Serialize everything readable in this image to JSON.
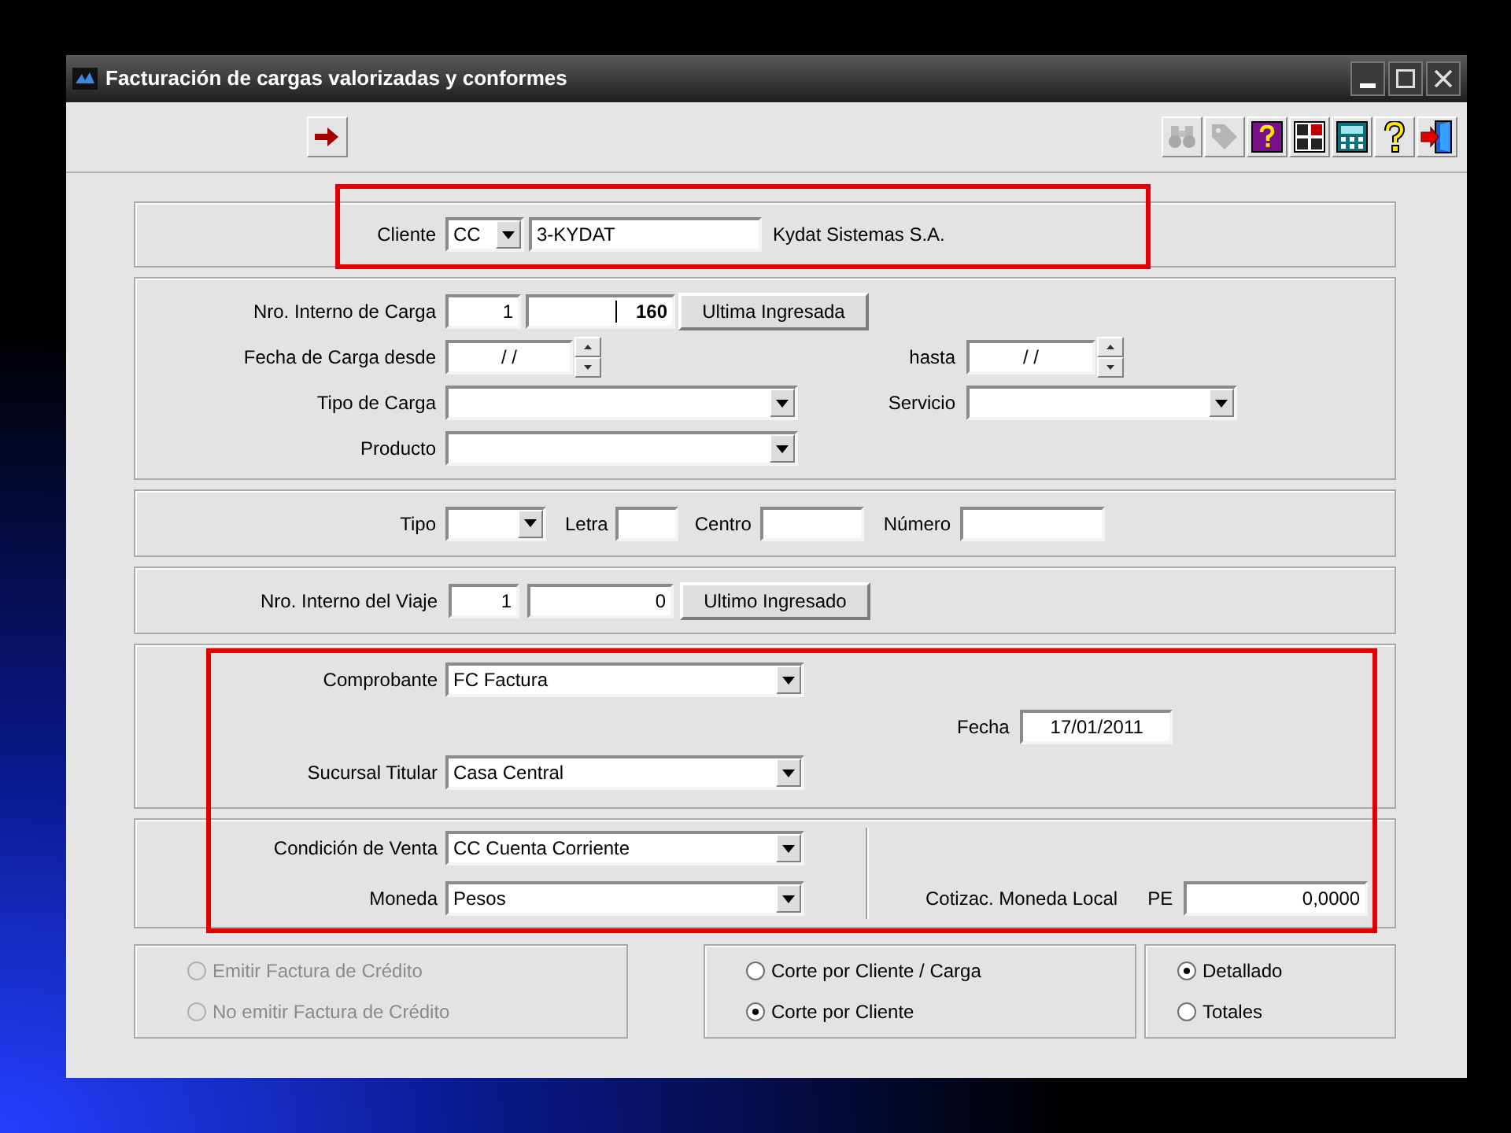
{
  "window": {
    "title": "Facturación de cargas valorizadas y conformes"
  },
  "left_tools": [
    {
      "kind": "arrow",
      "disabled": false
    }
  ],
  "right_tools": [
    {
      "kind": "binoculars",
      "disabled": true
    },
    {
      "kind": "tag",
      "disabled": true
    },
    {
      "kind": "help-box",
      "disabled": false
    },
    {
      "kind": "numbers",
      "disabled": false
    },
    {
      "kind": "calculator",
      "disabled": false
    },
    {
      "kind": "question",
      "disabled": false
    },
    {
      "kind": "exit",
      "disabled": false
    }
  ],
  "cliente": {
    "label": "Cliente",
    "type": "CC",
    "code": "3-KYDAT",
    "name": "Kydat Sistemas S.A."
  },
  "carga": {
    "nro_label": "Nro. Interno de Carga",
    "nro_1": "1",
    "nro_2": "160",
    "last_button": "Ultima Ingresada",
    "fecha_desde_label": "Fecha de Carga desde",
    "fecha_desde": "/ /",
    "hasta_label": "hasta",
    "fecha_hasta": "/ /",
    "tipo_label": "Tipo de Carga",
    "servicio_label": "Servicio",
    "producto_label": "Producto"
  },
  "documento": {
    "tipo_label": "Tipo",
    "letra_label": "Letra",
    "centro_label": "Centro",
    "numero_label": "Número"
  },
  "viaje": {
    "label": "Nro. Interno del Viaje",
    "nro_1": "1",
    "nro_2": "0",
    "last_button": "Ultimo Ingresado"
  },
  "comprobante": {
    "label": "Comprobante",
    "value": "FC Factura",
    "fecha_label": "Fecha",
    "fecha": "17/01/2011",
    "sucursal_label": "Sucursal Titular",
    "sucursal": "Casa Central"
  },
  "venta": {
    "condicion_label": "Condición de Venta",
    "condicion": "CC Cuenta Corriente",
    "moneda_label": "Moneda",
    "moneda": "Pesos",
    "cotizacion_label": "Cotizac. Moneda Local",
    "currency_code": "PE",
    "cotizacion": "0,0000"
  },
  "credito_options": [
    {
      "label": "Emitir Factura de Crédito",
      "selected": false,
      "disabled": true
    },
    {
      "label": "No emitir Factura de Crédito",
      "selected": false,
      "disabled": true
    }
  ],
  "corte_options": [
    {
      "label": "Corte por Cliente / Carga",
      "selected": false,
      "disabled": false
    },
    {
      "label": "Corte por Cliente",
      "selected": true,
      "disabled": false
    }
  ],
  "detalle_options": [
    {
      "label": "Detallado",
      "selected": true,
      "disabled": false
    },
    {
      "label": "Totales",
      "selected": false,
      "disabled": false
    }
  ]
}
